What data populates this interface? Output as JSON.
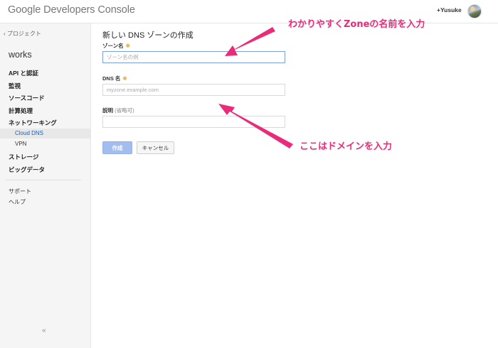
{
  "header": {
    "logo_text": "Google Developers Console",
    "user_label": "+Yusuke"
  },
  "sidebar": {
    "back_label": "‹ プロジェクト",
    "project_name": "works",
    "items": [
      {
        "label": "API と認証"
      },
      {
        "label": "監視"
      },
      {
        "label": "ソースコード"
      },
      {
        "label": "計算処理"
      },
      {
        "label": "ネットワーキング"
      },
      {
        "label": "Cloud DNS",
        "active": true
      },
      {
        "label": "VPN"
      },
      {
        "label": "ストレージ"
      },
      {
        "label": "ビッグデータ"
      }
    ],
    "footer_items": [
      {
        "label": "サポート"
      },
      {
        "label": "ヘルプ"
      }
    ],
    "collapse_label": "«"
  },
  "form": {
    "title": "新しい DNS ゾーンの作成",
    "zone_name": {
      "label": "ゾーン名",
      "required_mark": "✱",
      "placeholder": "ゾーン名の例",
      "value": ""
    },
    "dns_name": {
      "label": "DNS 名",
      "required_mark": "✱",
      "placeholder": "myzone.example.com",
      "value": ""
    },
    "description": {
      "label": "説明",
      "optional_hint": "(省略可)",
      "value": ""
    },
    "create_button": "作成",
    "cancel_button": "キャンセル"
  },
  "annotations": {
    "top": "わかりやすくZoneの名前を入力",
    "bottom": "ここはドメインを入力",
    "color": "#ec2a7a"
  },
  "colors": {
    "primary_button": "#a3bdf0",
    "active_nav": "#1a5fb4",
    "required_star": "#f2b440"
  }
}
